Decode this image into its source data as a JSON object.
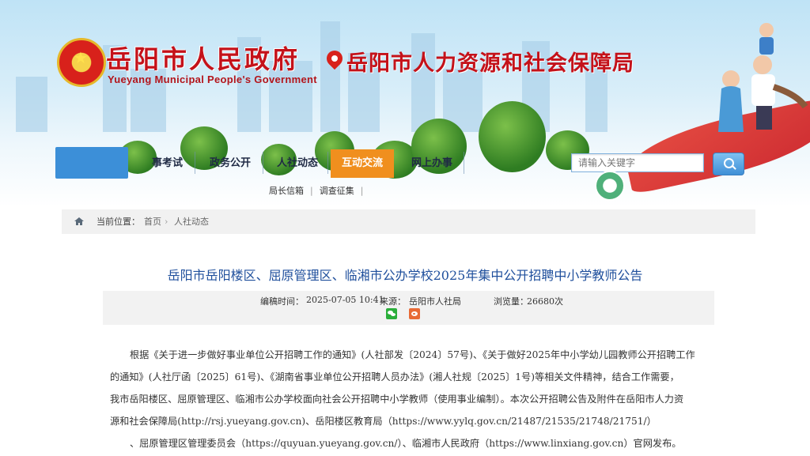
{
  "header": {
    "gov_title": "岳阳市人民政府",
    "gov_subtitle": "Yueyang Municipal People's Government",
    "dept_title": "岳阳市人力资源和社会保障局"
  },
  "nav": {
    "items": [
      {
        "label": "事考试"
      },
      {
        "label": "政务公开"
      },
      {
        "label": "人社动态"
      },
      {
        "label": "互动交流"
      },
      {
        "label": "网上办事"
      }
    ],
    "active_index": 3,
    "search_placeholder": "请输入关键字",
    "subnav": [
      "局长信箱",
      "调查征集"
    ]
  },
  "breadcrumb": {
    "current_label": "当前位置：",
    "items": [
      "首页",
      "人社动态"
    ]
  },
  "article": {
    "title": "岳阳市岳阳楼区、屈原管理区、临湘市公办学校2025年集中公开招聘中小学教师公告",
    "meta": {
      "date_label": "编稿时间：",
      "date": "2025-07-05 10:41",
      "source_label": "来源：",
      "source": "岳阳市人社局",
      "views_label": "浏览量：",
      "views": "26680次"
    },
    "lines": [
      "根据《关于进一步做好事业单位公开招聘工作的通知》(人社部发〔2024〕57号)、《关于做好2025年中小学幼儿园教师公开招聘工作",
      "的通知》(人社厅函〔2025〕61号)、《湖南省事业单位公开招聘人员办法》(湘人社规〔2025〕1号)等相关文件精神，结合工作需要，",
      "我市岳阳楼区、屈原管理区、临湘市公办学校面向社会公开招聘中小学教师（使用事业编制）。本次公开招聘公告及附件在岳阳市人力资",
      "源和社会保障局(http://rsj.yueyang.gov.cn)、岳阳楼区教育局（https://www.yylq.gov.cn/21487/21535/21748/21751/）",
      "、屈原管理区管理委员会（https://quyuan.yueyang.gov.cn/）、临湘市人民政府（https://www.linxiang.gov.cn）官网发布。"
    ]
  },
  "colors": {
    "brand_red": "#c4121a",
    "nav_active": "#f08f1e",
    "title_blue": "#1f4f9c"
  }
}
